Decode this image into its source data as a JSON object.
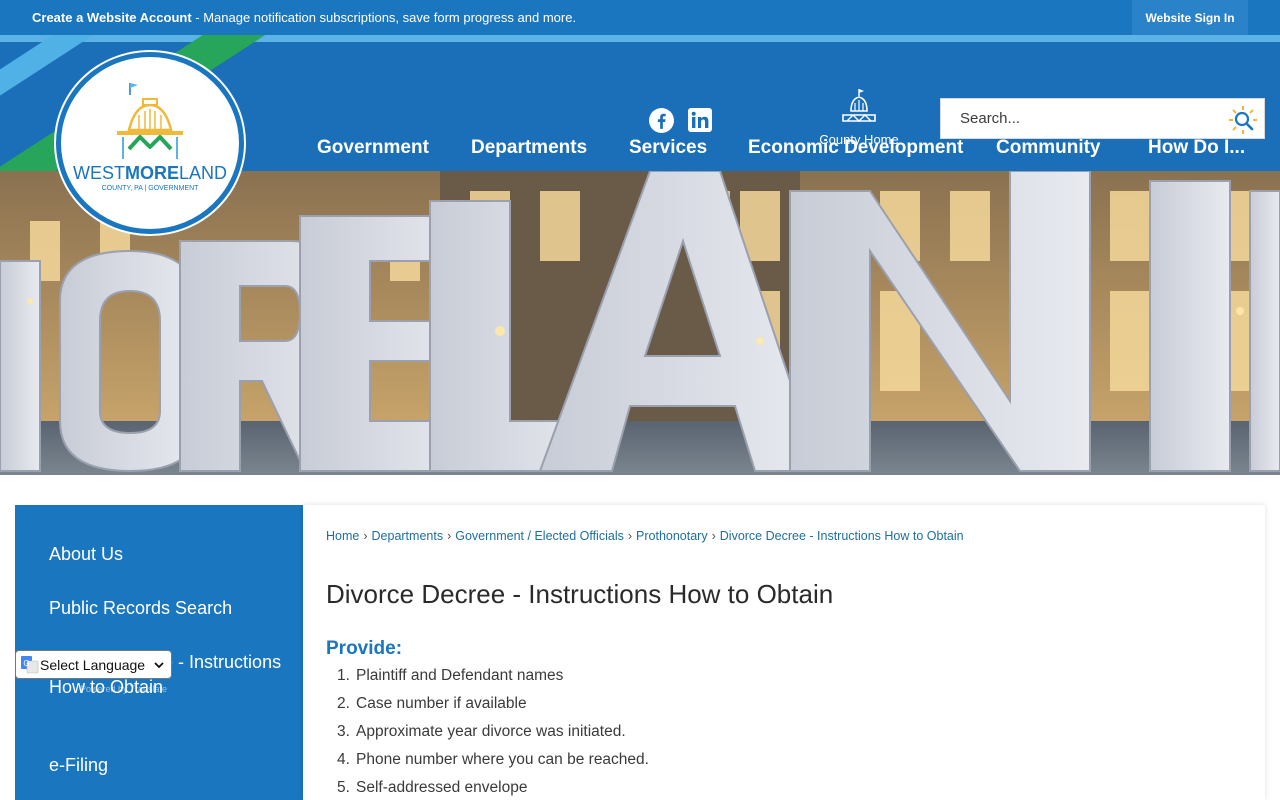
{
  "topbar": {
    "message_bold": "Create a Website Account",
    "message_rest": " - Manage notification subscriptions, save form progress and more.",
    "signin_label": "Website Sign In"
  },
  "logo": {
    "name_light_1": "WEST",
    "name_bold": "MORE",
    "name_light_2": "LAND",
    "subtitle": "COUNTY, PA | GOVERNMENT"
  },
  "header": {
    "county_home_label": "County Home",
    "search_placeholder": "Search..."
  },
  "nav": {
    "items": [
      "Government",
      "Departments",
      "Services",
      "Economic Development",
      "Community",
      "How Do I..."
    ]
  },
  "sidebar": {
    "items": [
      {
        "label": "About Us"
      },
      {
        "label": "Public Records Search"
      },
      {
        "label": "Divorce Decree - Instructions How to Obtain"
      },
      {
        "label": "e-Filing"
      }
    ]
  },
  "translate": {
    "label": "Select Language",
    "powered": "Powered by Translate"
  },
  "breadcrumb": [
    "Home",
    "Departments",
    "Government / Elected Officials",
    "Prothonotary",
    "Divorce Decree - Instructions How to Obtain"
  ],
  "main": {
    "title": "Divorce Decree - Instructions How to Obtain",
    "section_heading": "Provide:",
    "steps": [
      "Plaintiff and Defendant names",
      "Case number if available",
      "Approximate year divorce was initiated.",
      "Phone number where you can be reached.",
      "Self-addressed envelope"
    ]
  },
  "colors": {
    "brand_blue": "#1a76bf",
    "accent_green": "#27a55a",
    "accent_light_blue": "#5bb3e6",
    "link_teal": "#1e6f9f"
  }
}
